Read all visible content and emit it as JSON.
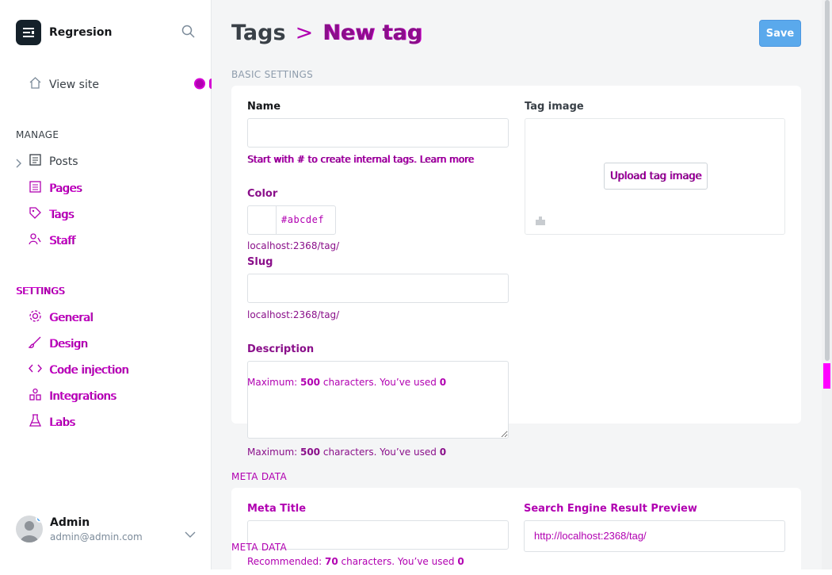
{
  "app": {
    "name": "Regresion"
  },
  "nav": {
    "view_site": "View site",
    "manage_header": "MANAGE",
    "manage_items": [
      {
        "label": "Posts",
        "icon": "posts-icon"
      },
      {
        "label": "Pages",
        "icon": "pages-icon"
      },
      {
        "label": "Tags",
        "icon": "tags-icon"
      },
      {
        "label": "Staff",
        "icon": "staff-icon"
      }
    ],
    "settings_header": "SETTINGS",
    "settings_items": [
      {
        "label": "General",
        "icon": "gear-icon"
      },
      {
        "label": "Design",
        "icon": "brush-icon"
      },
      {
        "label": "Code injection",
        "icon": "code-icon"
      },
      {
        "label": "Integrations",
        "icon": "integrations-icon"
      },
      {
        "label": "Labs",
        "icon": "flask-icon"
      }
    ]
  },
  "user": {
    "name": "Admin",
    "email": "admin@admin.com"
  },
  "header": {
    "breadcrumb_parent": "Tags",
    "breadcrumb_sep": ">",
    "title": "New tag",
    "save_label": "Save"
  },
  "basic": {
    "section_title": "BASIC SETTINGS",
    "name_label": "Name",
    "name_value": "",
    "name_hint": "Start with # to create internal tags. Learn more",
    "color_label": "Color",
    "color_placeholder": "#abcdef",
    "slug_url": "localhost:2368/tag/",
    "slug_label": "Slug",
    "slug_value": "",
    "description_label": "Description",
    "description_value": "",
    "description_hint_pre": "Maximum: ",
    "description_max": "500",
    "description_hint_mid": " characters. You’ve used ",
    "description_used": "0",
    "tag_image_label": "Tag image",
    "upload_label": "Upload tag image"
  },
  "meta": {
    "section_title": "META DATA",
    "meta_title_label": "Meta Title",
    "meta_title_value": "",
    "meta_hint_pre": "Recommended: ",
    "meta_hint_num": "70",
    "meta_hint_mid": " characters. You’ve used ",
    "meta_hint_used": "0",
    "serp_label": "Search Engine Result Preview",
    "serp_url": "http://localhost:2368/tag/"
  },
  "colors": {
    "accent": "#5aa9ec",
    "artifact": "#d400d4"
  }
}
